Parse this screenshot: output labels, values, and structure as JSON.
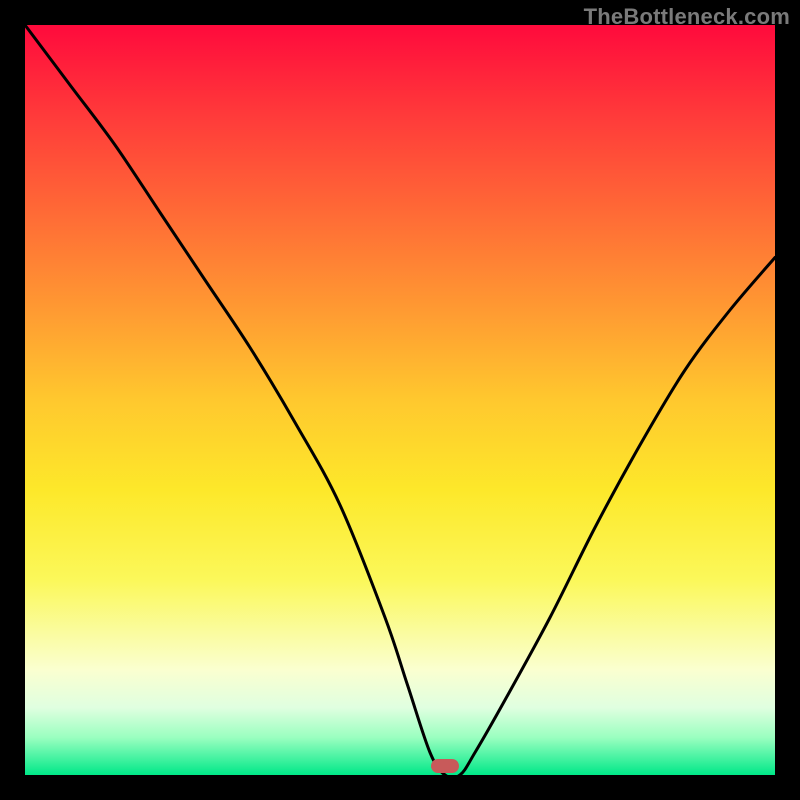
{
  "watermark": "TheBottleneck.com",
  "chart_data": {
    "type": "line",
    "title": "",
    "xlabel": "",
    "ylabel": "",
    "xlim": [
      0,
      100
    ],
    "ylim": [
      0,
      100
    ],
    "marker": {
      "x": 56,
      "color": "#c85a5a"
    },
    "series": [
      {
        "name": "bottleneck",
        "x": [
          0,
          6,
          12,
          18,
          24,
          30,
          36,
          42,
          48,
          51,
          54,
          56,
          58,
          60,
          64,
          70,
          76,
          82,
          88,
          94,
          100
        ],
        "y": [
          100,
          92,
          84,
          75,
          66,
          57,
          47,
          36,
          21,
          12,
          3,
          0,
          0,
          3,
          10,
          21,
          33,
          44,
          54,
          62,
          69
        ]
      }
    ],
    "colors": {
      "curve": "#000000",
      "gradient_top": "#ff0a3c",
      "gradient_bottom": "#00e888",
      "marker": "#c85a5a",
      "frame": "#000000"
    }
  }
}
